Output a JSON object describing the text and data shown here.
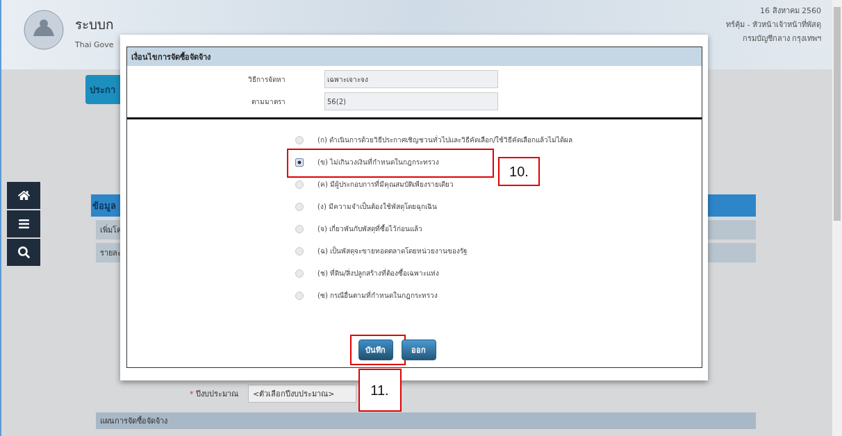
{
  "header": {
    "title": "ระบบก",
    "subtitle": "Thai Gove",
    "date": "16 สิงหาคม 2560",
    "user": "ทร์คุ้ม - หัวหน้าเจ้าหน้าที่พัสดุ",
    "org": "กรมบัญชีกลาง กรุงเทพฯ"
  },
  "background": {
    "tab": "ประกา",
    "section": "ข้อมูล",
    "rows": [
      "เพิ่มโค",
      "รายละ"
    ],
    "budget_mark": "*",
    "budget_label": "ปีงบประมาณ",
    "budget_select": "<ตัวเลือกปีงบประมาณ>",
    "plan_bar": "แผนการจัดซื้อจัดจ้าง"
  },
  "dialog": {
    "title": "เงื่อนไขการจัดซื้อจัดจ้าง",
    "fields": [
      {
        "label": "วิธีการจัดหา",
        "value": "เฉพาะเจาะจง"
      },
      {
        "label": "ตามมาตรา",
        "value": "56(2)"
      }
    ],
    "options": [
      {
        "label": "(ก) ดำเนินการด้วยวิธีประกาศเชิญชวนทั่วไปและวิธีคัดเลือก/ใช้วิธีคัดเลือกแล้วไม่ได้ผล",
        "selected": false
      },
      {
        "label": "(ข) ไม่เกินวงเงินที่กำหนดในกฎกระทรวง",
        "selected": true,
        "callout": "10."
      },
      {
        "label": "(ค) มีผู้ประกอบการที่มีคุณสมบัติเพียงรายเดียว",
        "selected": false
      },
      {
        "label": "(ง) มีความจำเป็นต้องใช้พัสดุโดยฉุกเฉิน",
        "selected": false
      },
      {
        "label": "(จ) เกี่ยวพันกับพัสดุที่ซื้อไว้ก่อนแล้ว",
        "selected": false
      },
      {
        "label": "(ฉ) เป็นพัสดุจะขายทอดตลาดโดยหน่วยงานของรัฐ",
        "selected": false
      },
      {
        "label": "(ช) ที่ดิน/สิ่งปลูกสร้างที่ต้องซื้อเฉพาะแห่ง",
        "selected": false
      },
      {
        "label": "(ซ) กรณีอื่นตามที่กำหนดในกฎกระทรวง",
        "selected": false
      }
    ],
    "buttons": [
      {
        "label": "บันทึก",
        "kind": "save",
        "callout": "11."
      },
      {
        "label": "ออก",
        "kind": "exit"
      }
    ]
  }
}
